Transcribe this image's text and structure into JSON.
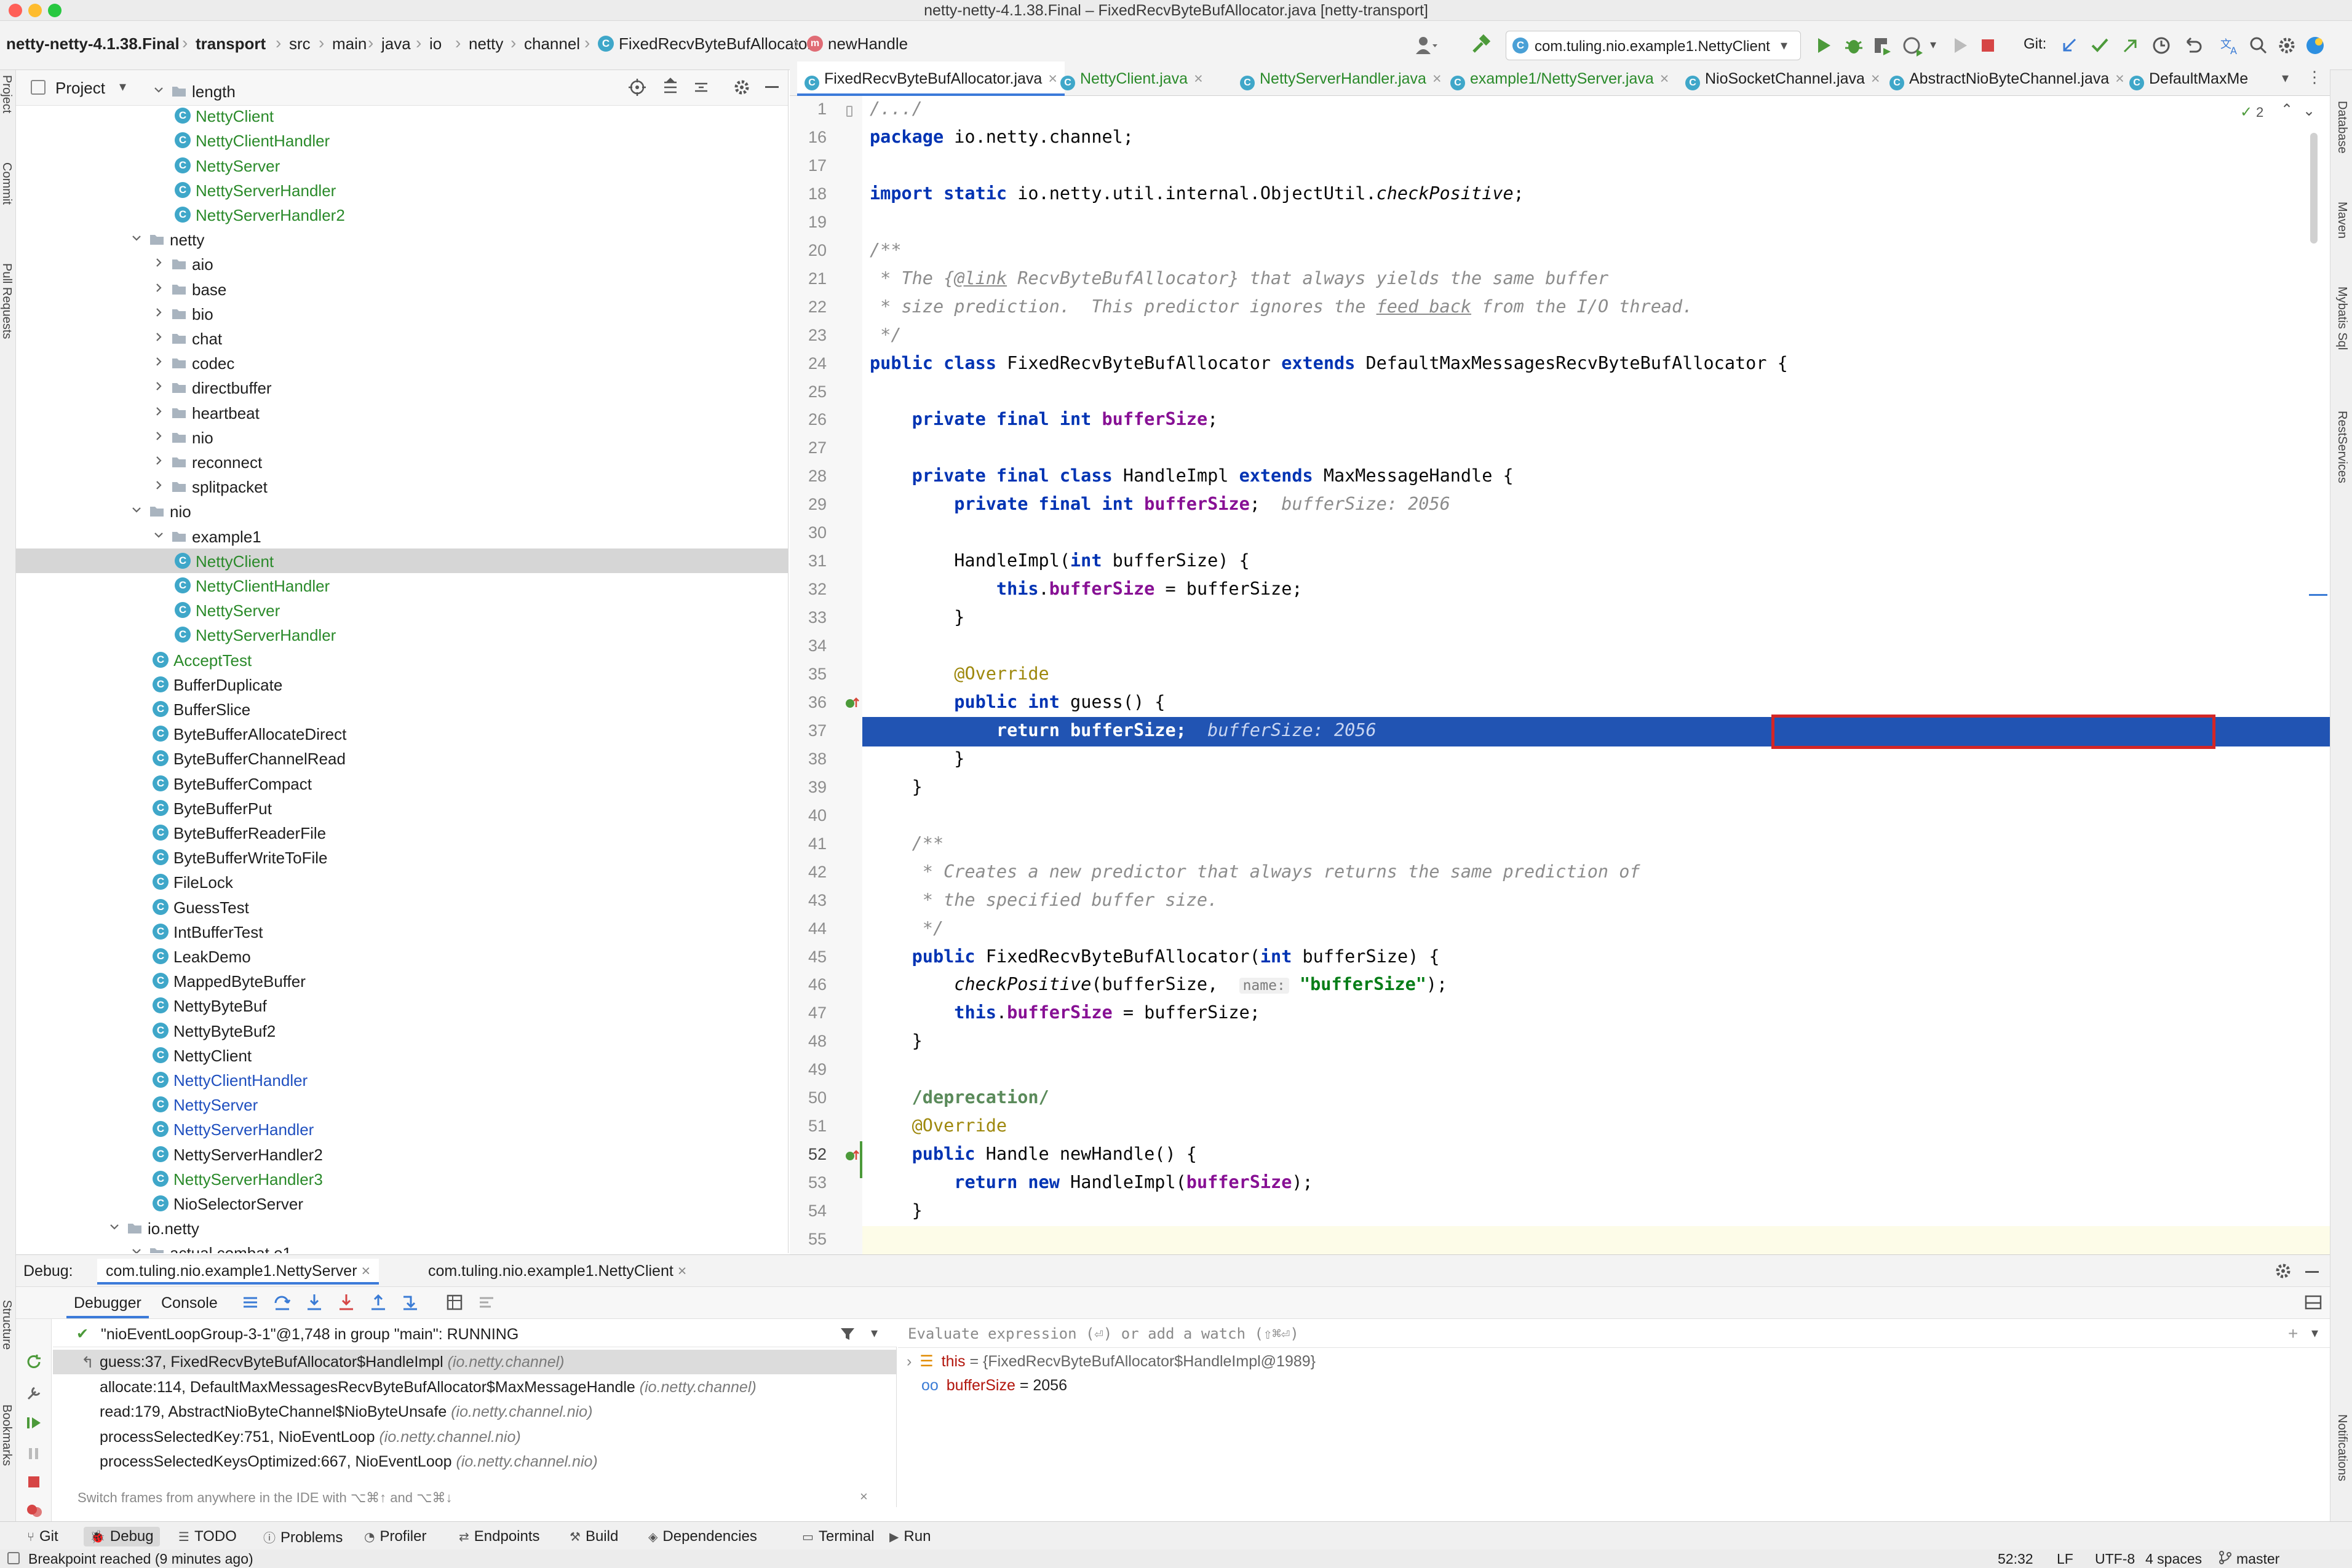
{
  "window": {
    "title": "netty-netty-4.1.38.Final – FixedRecvByteBufAllocator.java [netty-transport]"
  },
  "navbar": {
    "breadcrumbs": [
      "netty-netty-4.1.38.Final",
      "transport",
      "src",
      "main",
      "java",
      "io",
      "netty",
      "channel",
      "FixedRecvByteBufAllocator",
      "newHandle"
    ],
    "run_config": "com.tuling.nio.example1.NettyClient",
    "git_label": "Git:"
  },
  "left_stripe": [
    "Project",
    "Commit",
    "Pull Requests",
    "Structure",
    "Bookmarks"
  ],
  "right_stripe": [
    "Database",
    "Maven",
    "Mybatis Sql",
    "RestServices",
    "Notifications"
  ],
  "project": {
    "title": "Project",
    "tree": [
      {
        "label": "length",
        "type": "folder",
        "depth": 4,
        "open": true,
        "color": "normal"
      },
      {
        "label": "NettyClient",
        "type": "class",
        "depth": 5,
        "color": "green"
      },
      {
        "label": "NettyClientHandler",
        "type": "class",
        "depth": 5,
        "color": "green"
      },
      {
        "label": "NettyServer",
        "type": "class",
        "depth": 5,
        "color": "green"
      },
      {
        "label": "NettyServerHandler",
        "type": "class",
        "depth": 5,
        "color": "green"
      },
      {
        "label": "NettyServerHandler2",
        "type": "class",
        "depth": 5,
        "color": "green"
      },
      {
        "label": "netty",
        "type": "folder",
        "depth": 3,
        "open": true,
        "color": "normal"
      },
      {
        "label": "aio",
        "type": "folder",
        "depth": 4,
        "open": false,
        "color": "normal"
      },
      {
        "label": "base",
        "type": "folder",
        "depth": 4,
        "open": false,
        "color": "normal"
      },
      {
        "label": "bio",
        "type": "folder",
        "depth": 4,
        "open": false,
        "color": "normal"
      },
      {
        "label": "chat",
        "type": "folder",
        "depth": 4,
        "open": false,
        "color": "normal"
      },
      {
        "label": "codec",
        "type": "folder",
        "depth": 4,
        "open": false,
        "color": "normal"
      },
      {
        "label": "directbuffer",
        "type": "folder",
        "depth": 4,
        "open": false,
        "color": "normal"
      },
      {
        "label": "heartbeat",
        "type": "folder",
        "depth": 4,
        "open": false,
        "color": "normal"
      },
      {
        "label": "nio",
        "type": "folder",
        "depth": 4,
        "open": false,
        "color": "normal"
      },
      {
        "label": "reconnect",
        "type": "folder",
        "depth": 4,
        "open": false,
        "color": "normal"
      },
      {
        "label": "splitpacket",
        "type": "folder",
        "depth": 4,
        "open": false,
        "color": "normal"
      },
      {
        "label": "nio",
        "type": "folder",
        "depth": 3,
        "open": true,
        "color": "normal"
      },
      {
        "label": "example1",
        "type": "folder",
        "depth": 4,
        "open": true,
        "color": "normal"
      },
      {
        "label": "NettyClient",
        "type": "class",
        "depth": 5,
        "color": "green",
        "selected": true
      },
      {
        "label": "NettyClientHandler",
        "type": "class",
        "depth": 5,
        "color": "green"
      },
      {
        "label": "NettyServer",
        "type": "class",
        "depth": 5,
        "color": "green"
      },
      {
        "label": "NettyServerHandler",
        "type": "class",
        "depth": 5,
        "color": "green"
      },
      {
        "label": "AcceptTest",
        "type": "class",
        "depth": 4,
        "color": "green"
      },
      {
        "label": "BufferDuplicate",
        "type": "class",
        "depth": 4,
        "color": "normal"
      },
      {
        "label": "BufferSlice",
        "type": "class",
        "depth": 4,
        "color": "normal"
      },
      {
        "label": "ByteBufferAllocateDirect",
        "type": "class",
        "depth": 4,
        "color": "normal"
      },
      {
        "label": "ByteBufferChannelRead",
        "type": "class",
        "depth": 4,
        "color": "normal"
      },
      {
        "label": "ByteBufferCompact",
        "type": "class",
        "depth": 4,
        "color": "normal"
      },
      {
        "label": "ByteBufferPut",
        "type": "class",
        "depth": 4,
        "color": "normal"
      },
      {
        "label": "ByteBufferReaderFile",
        "type": "class",
        "depth": 4,
        "color": "normal"
      },
      {
        "label": "ByteBufferWriteToFile",
        "type": "class",
        "depth": 4,
        "color": "normal"
      },
      {
        "label": "FileLock",
        "type": "class",
        "depth": 4,
        "color": "normal"
      },
      {
        "label": "GuessTest",
        "type": "class",
        "depth": 4,
        "color": "normal"
      },
      {
        "label": "IntBufferTest",
        "type": "class",
        "depth": 4,
        "color": "normal"
      },
      {
        "label": "LeakDemo",
        "type": "class",
        "depth": 4,
        "color": "normal"
      },
      {
        "label": "MappedByteBuffer",
        "type": "class",
        "depth": 4,
        "color": "normal"
      },
      {
        "label": "NettyByteBuf",
        "type": "class",
        "depth": 4,
        "color": "normal"
      },
      {
        "label": "NettyByteBuf2",
        "type": "class",
        "depth": 4,
        "color": "normal"
      },
      {
        "label": "NettyClient",
        "type": "class",
        "depth": 4,
        "color": "normal"
      },
      {
        "label": "NettyClientHandler",
        "type": "class",
        "depth": 4,
        "color": "blue"
      },
      {
        "label": "NettyServer",
        "type": "class",
        "depth": 4,
        "color": "blue"
      },
      {
        "label": "NettyServerHandler",
        "type": "class",
        "depth": 4,
        "color": "blue"
      },
      {
        "label": "NettyServerHandler2",
        "type": "class",
        "depth": 4,
        "color": "normal"
      },
      {
        "label": "NettyServerHandler3",
        "type": "class",
        "depth": 4,
        "color": "green"
      },
      {
        "label": "NioSelectorServer",
        "type": "class",
        "depth": 4,
        "color": "normal"
      },
      {
        "label": "io.netty",
        "type": "folder",
        "depth": 2,
        "open": true,
        "color": "normal"
      },
      {
        "label": "actual.combat.e1",
        "type": "folder",
        "depth": 3,
        "open": true,
        "color": "normal"
      }
    ]
  },
  "editor": {
    "tabs": [
      {
        "label": "FixedRecvByteBufAllocator.java",
        "active": true,
        "color": "normal"
      },
      {
        "label": "NettyClient.java",
        "color": "green"
      },
      {
        "label": "NettyServerHandler.java",
        "color": "green"
      },
      {
        "label": "example1/NettyServer.java",
        "color": "green"
      },
      {
        "label": "NioSocketChannel.java",
        "color": "normal"
      },
      {
        "label": "AbstractNioByteChannel.java",
        "color": "normal"
      },
      {
        "label": "DefaultMaxMe",
        "color": "normal"
      }
    ],
    "problems_count": "2",
    "lines": [
      {
        "n": "1",
        "html": "<span class=\"cmt\">/.../</span>"
      },
      {
        "n": "16",
        "html": "<span class=\"kw\">package</span> io.netty.channel;"
      },
      {
        "n": "17",
        "html": ""
      },
      {
        "n": "18",
        "html": "<span class=\"kw\">import static</span> io.netty.util.internal.ObjectUtil.<span class=\"ital\">checkPositive</span>;"
      },
      {
        "n": "19",
        "html": ""
      },
      {
        "n": "20",
        "html": "<span class=\"cmt\">/**</span>"
      },
      {
        "n": "21",
        "html": "<span class=\"cmt\"> * The {<u>@link</u> RecvByteBufAllocator} that always yields the same buffer</span>"
      },
      {
        "n": "22",
        "html": "<span class=\"cmt\"> * size prediction.  This predictor ignores the <u>feed back</u> from the I/O thread.</span>"
      },
      {
        "n": "23",
        "html": "<span class=\"cmt\"> */</span>"
      },
      {
        "n": "24",
        "html": "<span class=\"kw\">public class</span> FixedRecvByteBufAllocator <span class=\"kw\">extends</span> DefaultMaxMessagesRecvByteBufAllocator {"
      },
      {
        "n": "25",
        "html": ""
      },
      {
        "n": "26",
        "html": "    <span class=\"kw\">private final int</span> <span class=\"fld\">bufferSize</span>;"
      },
      {
        "n": "27",
        "html": ""
      },
      {
        "n": "28",
        "html": "    <span class=\"kw\">private final class</span> HandleImpl <span class=\"kw\">extends</span> MaxMessageHandle {"
      },
      {
        "n": "29",
        "html": "        <span class=\"kw\">private final int</span> <span class=\"fld\">bufferSize</span>;  <span class=\"hint\">bufferSize: 2056</span>"
      },
      {
        "n": "30",
        "html": ""
      },
      {
        "n": "31",
        "html": "        HandleImpl(<span class=\"kw\">int</span> bufferSize) {"
      },
      {
        "n": "32",
        "html": "            <span class=\"kw\">this</span>.<span class=\"fld\">bufferSize</span> = bufferSize;"
      },
      {
        "n": "33",
        "html": "        }"
      },
      {
        "n": "34",
        "html": ""
      },
      {
        "n": "35",
        "html": "        <span class=\"ann\">@Override</span>"
      },
      {
        "n": "36",
        "html": "        <span class=\"kw\">public int</span> guess() {"
      },
      {
        "n": "37",
        "html": "            <span style=\"color:#fff;font-weight:bold\">return bufferSize;</span>  <span style=\"color:#c9d6f2;font-style:italic\">bufferSize: 2056</span>",
        "current": true
      },
      {
        "n": "38",
        "html": "        }"
      },
      {
        "n": "39",
        "html": "    }"
      },
      {
        "n": "40",
        "html": ""
      },
      {
        "n": "41",
        "html": "    <span class=\"cmt\">/**</span>"
      },
      {
        "n": "42",
        "html": "<span class=\"cmt\">     * Creates a new predictor that always returns the same prediction of</span>"
      },
      {
        "n": "43",
        "html": "<span class=\"cmt\">     * the specified buffer size.</span>"
      },
      {
        "n": "44",
        "html": "<span class=\"cmt\">     */</span>"
      },
      {
        "n": "45",
        "html": "    <span class=\"kw\">public</span> FixedRecvByteBufAllocator(<span class=\"kw\">int</span> bufferSize) {"
      },
      {
        "n": "46",
        "html": "        <span class=\"ital\">checkPositive</span>(bufferSize,  <span class=\"hintbox\">name:</span> <span class=\"str\">\"bufferSize\"</span>);"
      },
      {
        "n": "47",
        "html": "        <span class=\"kw\">this</span>.<span class=\"fld\">bufferSize</span> = bufferSize;"
      },
      {
        "n": "48",
        "html": "    }"
      },
      {
        "n": "49",
        "html": ""
      },
      {
        "n": "50",
        "html": "    <span class=\"cmt\" style=\"color:#5a8a5a;font-weight:bold;font-style:normal\">/deprecation/</span>"
      },
      {
        "n": "51",
        "html": "    <span class=\"ann\">@Override</span>"
      },
      {
        "n": "52",
        "html": "    <span class=\"kw\">public</span> Handle newHandle() {"
      },
      {
        "n": "53",
        "html": "        <span class=\"kw\">return new</span> HandleImpl(<span class=\"fld\">bufferSize</span>);"
      },
      {
        "n": "54",
        "html": "    }"
      },
      {
        "n": "55",
        "html": ""
      }
    ]
  },
  "debug": {
    "label": "Debug:",
    "sessions": [
      "com.tuling.nio.example1.NettyServer",
      "com.tuling.nio.example1.NettyClient"
    ],
    "subtabs": [
      "Debugger",
      "Console"
    ],
    "thread": "\"nioEventLoopGroup-3-1\"@1,748 in group \"main\": RUNNING",
    "frames": [
      {
        "method": "guess:37, FixedRecvByteBufAllocator$HandleImpl",
        "pkg": "(io.netty.channel)",
        "selected": true
      },
      {
        "method": "allocate:114, DefaultMaxMessagesRecvByteBufAllocator$MaxMessageHandle",
        "pkg": "(io.netty.channel)"
      },
      {
        "method": "read:179, AbstractNioByteChannel$NioByteUnsafe",
        "pkg": "(io.netty.channel.nio)"
      },
      {
        "method": "processSelectedKey:751, NioEventLoop",
        "pkg": "(io.netty.channel.nio)"
      },
      {
        "method": "processSelectedKeysOptimized:667, NioEventLoop",
        "pkg": "(io.netty.channel.nio)"
      }
    ],
    "frames_hint": "Switch frames from anywhere in the IDE with ⌥⌘↑ and ⌥⌘↓",
    "eval_placeholder": "Evaluate expression (⏎) or add a watch (⇧⌘⏎)",
    "vars": [
      {
        "name": "this",
        "value": " = {FixedRecvByteBufAllocator$HandleImpl@1989}"
      },
      {
        "name": "bufferSize",
        "value": " = 2056"
      }
    ]
  },
  "bottom_tabs": [
    "Git",
    "Debug",
    "TODO",
    "Problems",
    "Profiler",
    "Endpoints",
    "Build",
    "Dependencies",
    "Terminal",
    "Run"
  ],
  "status": {
    "message": "Breakpoint reached (9 minutes ago)",
    "position": "52:32",
    "line_sep": "LF",
    "encoding": "UTF-8",
    "indent": "4 spaces",
    "branch": "master"
  }
}
